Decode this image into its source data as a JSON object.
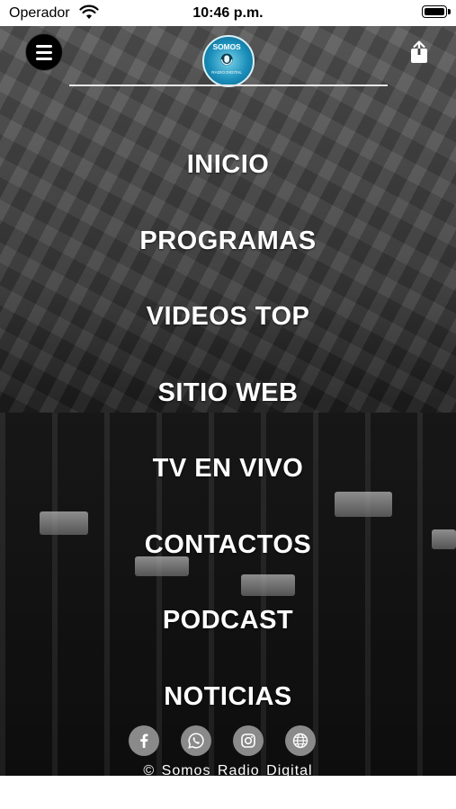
{
  "status_bar": {
    "carrier": "Operador",
    "time": "10:46 p.m."
  },
  "header": {
    "logo_text": "Somos Radio Digital",
    "accent": "#1a8fbb"
  },
  "menu": {
    "items": [
      {
        "label": "INICIO"
      },
      {
        "label": "PROGRAMAS"
      },
      {
        "label": "VIDEOS TOP"
      },
      {
        "label": "SITIO WEB"
      },
      {
        "label": "TV EN VIVO"
      },
      {
        "label": "CONTACTOS"
      },
      {
        "label": "PODCAST"
      },
      {
        "label": "NOTICIAS"
      }
    ]
  },
  "social": {
    "icons": [
      "facebook-icon",
      "whatsapp-icon",
      "instagram-icon",
      "globe-icon"
    ],
    "icon_bg": "#8a8a8a"
  },
  "footer": {
    "copyright": "© Somos Radio Digital"
  }
}
